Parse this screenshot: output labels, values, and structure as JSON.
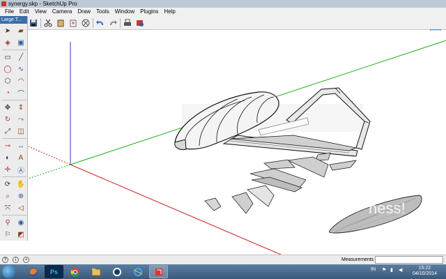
{
  "window": {
    "title": "synergy.skp - SketchUp Pro"
  },
  "menu": {
    "items": [
      "File",
      "Edit",
      "View",
      "Camera",
      "Draw",
      "Tools",
      "Window",
      "Plugins",
      "Help"
    ]
  },
  "toolbar": {
    "icons": [
      "save-icon",
      "cut-icon",
      "paste-icon",
      "erase-icon",
      "delete-icon",
      "undo-icon",
      "redo-icon",
      "print-icon",
      "model-info-icon"
    ]
  },
  "view_tools": {
    "icons": [
      "orbit-view-icon",
      "iso-view-icon",
      "top-view-icon"
    ]
  },
  "tool_panel": {
    "title": "Large T...",
    "tools": [
      "select-icon",
      "eraser-icon",
      "paint-bucket-icon",
      "component-icon",
      "rectangle-icon",
      "line-icon",
      "circle-icon",
      "freehand-icon",
      "polygon-icon",
      "arc-icon",
      "pie-icon",
      "two-point-arc-icon",
      "move-icon",
      "push-pull-icon",
      "rotate-icon",
      "follow-me-icon",
      "scale-icon",
      "offset-icon",
      "tape-measure-icon",
      "dimension-icon",
      "protractor-icon",
      "text-icon",
      "axes-icon",
      "3d-text-icon",
      "orbit-icon",
      "pan-icon",
      "zoom-icon",
      "zoom-window-icon",
      "zoom-extents-icon",
      "previous-view-icon",
      "position-camera-icon",
      "look-around-icon",
      "walk-icon",
      "section-plane-icon"
    ]
  },
  "canvas": {
    "watermark": "ness!"
  },
  "status": {
    "measurements_label": "Measurements",
    "measurements_value": ""
  },
  "taskbar": {
    "apps": [
      "firefox-icon",
      "photoshop-icon",
      "chrome-icon",
      "explorer-icon",
      "steam-icon",
      "ie-icon",
      "sketchup-icon"
    ],
    "photoshop_label": "Ps",
    "language": "IN",
    "time": "15:22",
    "date": "04/10/2014"
  },
  "colors": {
    "red_axis": "#cc2222",
    "green_axis": "#22aa22",
    "blue_axis": "#2222cc",
    "taskbar": "#3a5a7c",
    "toolpanel_title": "#3c6ea8"
  }
}
